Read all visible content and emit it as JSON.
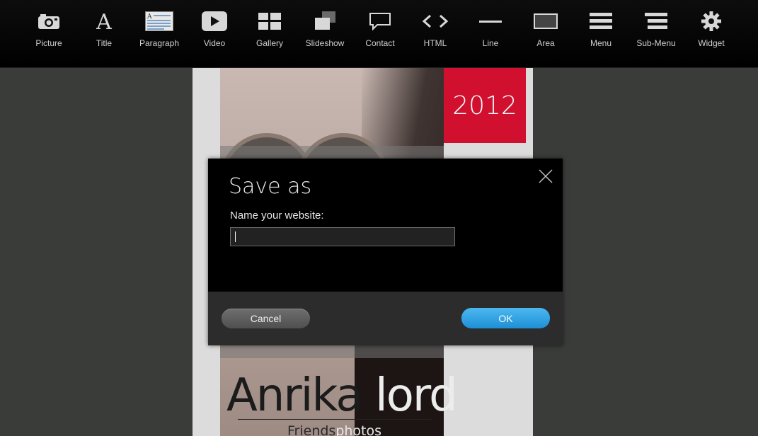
{
  "toolbar": {
    "items": [
      {
        "label": "Picture",
        "icon": "camera-icon"
      },
      {
        "label": "Title",
        "icon": "title-icon"
      },
      {
        "label": "Paragraph",
        "icon": "paragraph-icon"
      },
      {
        "label": "Video",
        "icon": "video-icon"
      },
      {
        "label": "Gallery",
        "icon": "gallery-icon"
      },
      {
        "label": "Slideshow",
        "icon": "slideshow-icon"
      },
      {
        "label": "Contact",
        "icon": "contact-icon"
      },
      {
        "label": "HTML",
        "icon": "html-icon"
      },
      {
        "label": "Line",
        "icon": "line-icon"
      },
      {
        "label": "Area",
        "icon": "area-icon"
      },
      {
        "label": "Menu",
        "icon": "menu-icon"
      },
      {
        "label": "Sub-Menu",
        "icon": "submenu-icon"
      },
      {
        "label": "Widget",
        "icon": "widget-gear-icon"
      }
    ]
  },
  "page": {
    "year": "2012",
    "first_name": "Anrika",
    "last_name": "lord",
    "subtitle_a": "Friends",
    "subtitle_b": "photos",
    "accent_color": "#d11030"
  },
  "dialog": {
    "title": "Save as",
    "label": "Name your website:",
    "input_value": "",
    "cancel_label": "Cancel",
    "ok_label": "OK",
    "ok_color": "#2aa3e6"
  }
}
